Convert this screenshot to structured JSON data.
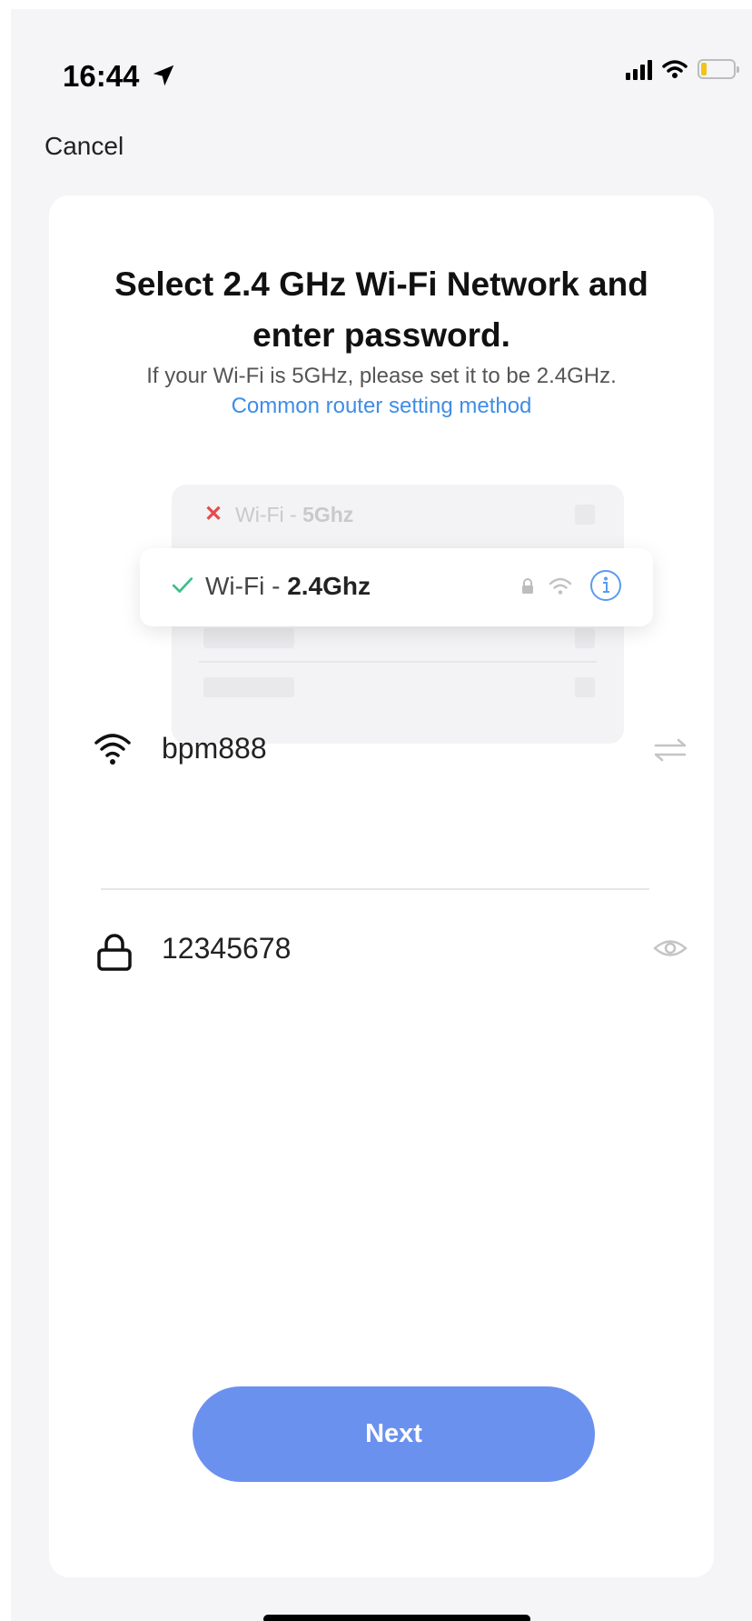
{
  "status_bar": {
    "time": "16:44",
    "icons": [
      "location-arrow-icon",
      "signal-icon",
      "wifi-icon",
      "battery-icon"
    ]
  },
  "nav": {
    "cancel_label": "Cancel"
  },
  "header": {
    "title": "Select 2.4 GHz Wi-Fi Network and enter password.",
    "subtitle": "If your Wi-Fi is 5GHz, please set it to be 2.4GHz.",
    "link": "Common router setting method"
  },
  "illustration": {
    "bad_network_prefix": "Wi-Fi - ",
    "bad_network_band": "5Ghz",
    "good_network_prefix": "Wi-Fi - ",
    "good_network_band": "2.4Ghz"
  },
  "form": {
    "ssid_value": "bpm888",
    "password_value": "12345678"
  },
  "actions": {
    "next_label": "Next"
  },
  "colors": {
    "accent": "#6b91ef",
    "link": "#3f8de6",
    "error": "#e54b4b",
    "success": "#3cbf8a"
  }
}
